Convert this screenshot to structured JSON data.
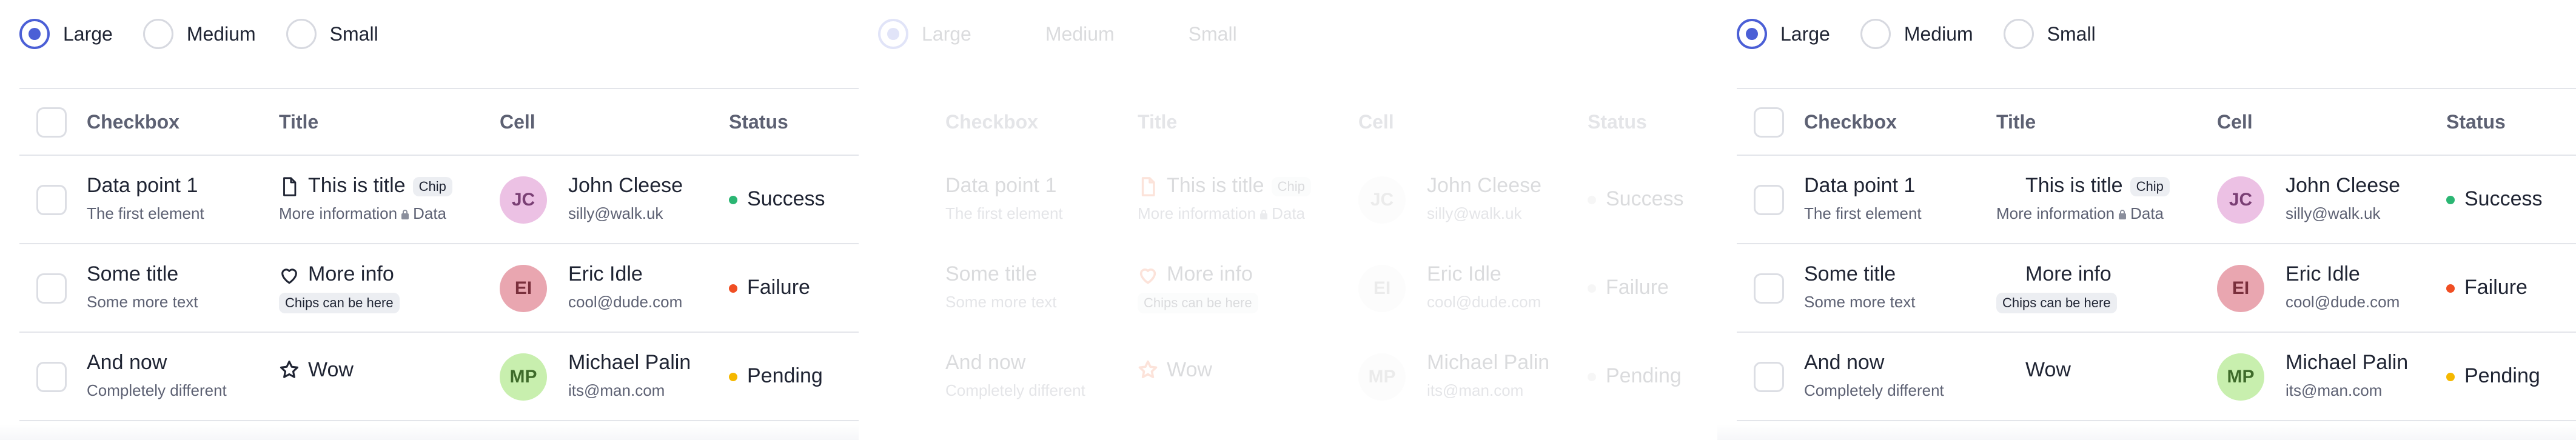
{
  "size_options": [
    "Large",
    "Medium",
    "Small"
  ],
  "headers": {
    "checkbox": "Checkbox",
    "title": "Title",
    "cell": "Cell",
    "status": "Status"
  },
  "rows": [
    {
      "checkbox_title": "Data point 1",
      "checkbox_subtitle": "The first element",
      "title": "This is title",
      "title_chip": "Chip",
      "title_sub_left": "More information",
      "title_sub_right": "Data",
      "title_icon": "file-icon",
      "initials": "JC",
      "name": "John Cleese",
      "email": "silly@walk.uk",
      "status": "Success"
    },
    {
      "checkbox_title": "Some title",
      "checkbox_subtitle": "Some more text",
      "title": "More info",
      "title_chip": "Chips can be here",
      "title_icon": "heart-icon",
      "initials": "EI",
      "name": "Eric Idle",
      "email": "cool@dude.com",
      "status": "Failure"
    },
    {
      "checkbox_title": "And now",
      "checkbox_subtitle": "Completely different",
      "title": "Wow",
      "title_icon": "star-icon",
      "initials": "MP",
      "name": "Michael Palin",
      "email": "its@man.com",
      "status": "Pending"
    }
  ],
  "colors": {
    "accent": "#4b5fd6",
    "success": "#2bb673",
    "failure": "#f04e23",
    "pending": "#f5b800",
    "avatar_jc": "#ecc1e4",
    "avatar_ei": "#e9a6b0",
    "avatar_mp": "#c8efae",
    "icon_orange": "#f15a22"
  }
}
